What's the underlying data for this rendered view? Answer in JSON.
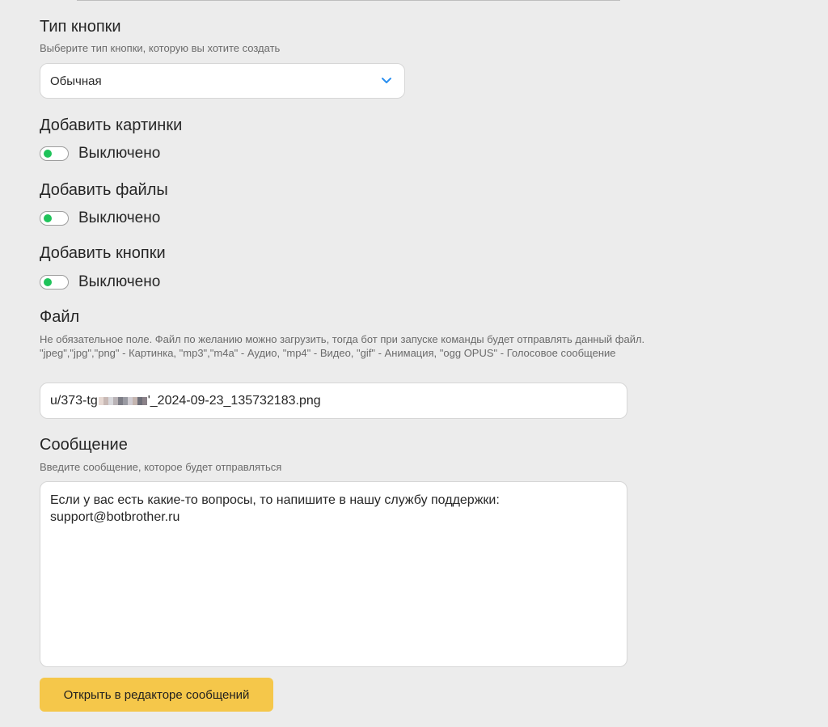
{
  "button_type": {
    "title": "Тип кнопки",
    "hint": "Выберите тип кнопки, которую вы хотите создать",
    "selected": "Обычная"
  },
  "toggles": [
    {
      "title": "Добавить картинки",
      "state_label": "Выключено"
    },
    {
      "title": "Добавить файлы",
      "state_label": "Выключено"
    },
    {
      "title": "Добавить кнопки",
      "state_label": "Выключено"
    }
  ],
  "file": {
    "title": "Файл",
    "hint": "Не обязательное поле. Файл по желанию можно загрузить, тогда бот при запуске команды будет отправлять данный файл. \"jpeg\",\"jpg\",\"png\" - Картинка, \"mp3\",\"m4a\" - Аудио, \"mp4\" - Видео, \"gif\" - Анимация, \"ogg OPUS\" - Голосовое сообщение",
    "value_prefix": "u/373-tg",
    "value_suffix": "'_2024-09-23_135732183.png"
  },
  "message": {
    "title": "Сообщение",
    "hint": "Введите сообщение, которое будет отправляться",
    "value": "Если у вас есть какие-то вопросы, то напишите в нашу службу поддержки:\nsupport@botbrother.ru"
  },
  "editor_button": {
    "label": "Открыть в редакторе сообщений"
  },
  "colors": {
    "accent_button": "#f5c74a",
    "toggle_knob": "#1fc35a",
    "chevron": "#2a8ff0",
    "background": "#ececec"
  }
}
